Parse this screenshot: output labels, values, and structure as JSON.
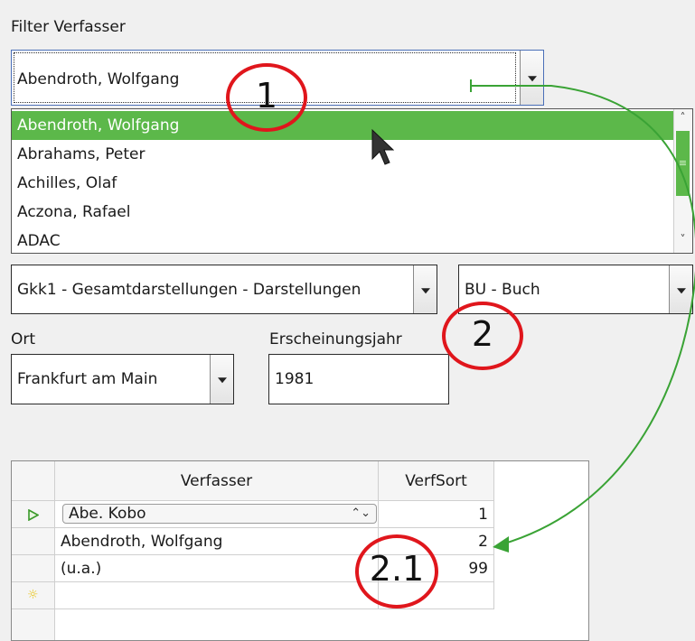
{
  "filter": {
    "label": "Filter Verfasser",
    "value": "Abendroth, Wolfgang",
    "options": [
      "Abendroth, Wolfgang",
      "Abrahams, Peter",
      "Achilles, Olaf",
      "Aczona, Rafael",
      "ADAC"
    ],
    "selected_option": "Abendroth, Wolfgang"
  },
  "scrollbar": {
    "thumb_glyph": "≡"
  },
  "category_combo": {
    "value": "Gkk1 - Gesamtdarstellungen - Darstellungen"
  },
  "medium_combo": {
    "value": "BU - Buch"
  },
  "ort": {
    "label": "Ort",
    "value": "Frankfurt am Main"
  },
  "jahr": {
    "label": "Erscheinungsjahr",
    "value": "1981"
  },
  "grid": {
    "headers": [
      "Verfasser",
      "VerfSort"
    ],
    "rows": [
      {
        "verfasser": "Abe. Kobo",
        "sort": "1"
      },
      {
        "verfasser": "Abendroth, Wolfgang",
        "sort": "2"
      },
      {
        "verfasser": "(u.a.)",
        "sort": "99"
      }
    ]
  },
  "annotations": {
    "m1": "1",
    "m2": "2",
    "m21": "2.1"
  },
  "colors": {
    "selection": "#5cb84a",
    "arrow": "#3aa335",
    "marker": "#e0161c"
  }
}
